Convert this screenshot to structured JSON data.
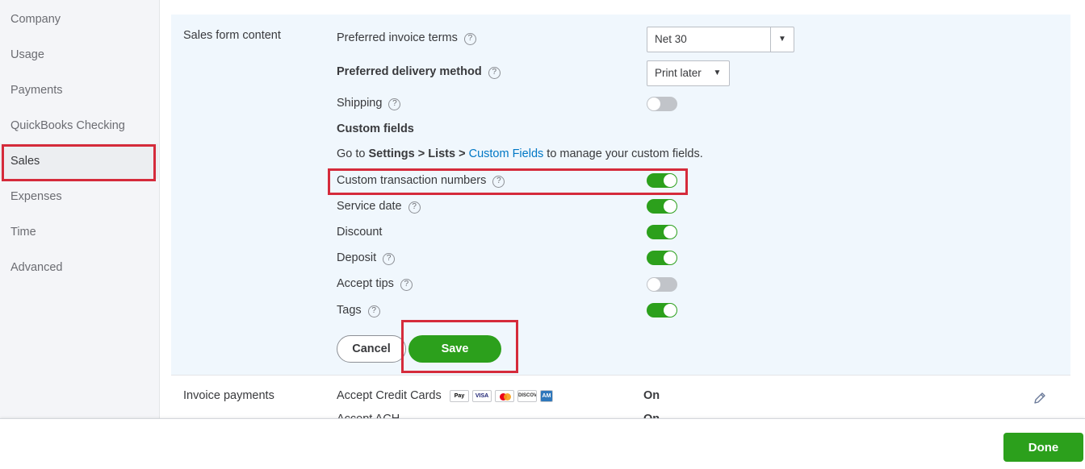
{
  "sidebar": {
    "items": [
      {
        "label": "Company"
      },
      {
        "label": "Usage"
      },
      {
        "label": "Payments"
      },
      {
        "label": "QuickBooks Checking"
      },
      {
        "label": "Sales"
      },
      {
        "label": "Expenses"
      },
      {
        "label": "Time"
      },
      {
        "label": "Advanced"
      }
    ],
    "active": "Sales"
  },
  "sales_form": {
    "title": "Sales form content",
    "invoice_terms": {
      "label": "Preferred invoice terms",
      "value": "Net 30"
    },
    "delivery_method": {
      "label": "Preferred delivery method",
      "value": "Print later"
    },
    "shipping": {
      "label": "Shipping",
      "on": false
    },
    "custom_fields": {
      "heading": "Custom fields",
      "prefix": "Go to ",
      "path": "Settings > Lists > ",
      "link": "Custom Fields",
      "suffix": " to manage your custom fields."
    },
    "custom_txn_numbers": {
      "label": "Custom transaction numbers",
      "on": true
    },
    "service_date": {
      "label": "Service date",
      "on": true
    },
    "discount": {
      "label": "Discount",
      "on": true
    },
    "deposit": {
      "label": "Deposit",
      "on": true
    },
    "accept_tips": {
      "label": "Accept tips",
      "on": false
    },
    "tags": {
      "label": "Tags",
      "on": true
    },
    "cancel_label": "Cancel",
    "save_label": "Save"
  },
  "invoice_payments": {
    "title": "Invoice payments",
    "accept_cards": {
      "label": "Accept Credit Cards",
      "status": "On"
    },
    "card_icons": [
      "apple-pay-icon",
      "visa-icon",
      "mastercard-icon",
      "discover-icon",
      "amex-icon"
    ],
    "card_icon_text": {
      "apple": "Pay",
      "visa": "VISA",
      "discover": "DISCOVER",
      "amex": "AM"
    },
    "next_row_label": "Accept ACH",
    "next_row_status": "On"
  },
  "footer": {
    "done_label": "Done"
  },
  "colors": {
    "accent_green": "#2ca01c",
    "highlight_red": "#d52b3b",
    "link_blue": "#0077c5",
    "section_bg": "#f0f7fd"
  }
}
